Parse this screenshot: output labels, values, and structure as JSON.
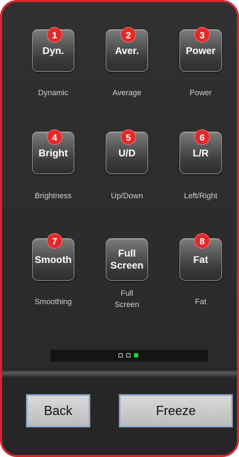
{
  "tiles": [
    {
      "label": "Dyn.",
      "badge": "1",
      "caption": "Dynamic"
    },
    {
      "label": "Aver.",
      "badge": "2",
      "caption": "Average"
    },
    {
      "label": "Power",
      "badge": "3",
      "caption": "Power"
    },
    {
      "label": "Bright",
      "badge": "4",
      "caption": "Brightness"
    },
    {
      "label": "U/D",
      "badge": "5",
      "caption": "Up/Down"
    },
    {
      "label": "L/R",
      "badge": "6",
      "caption": "Left/Right"
    },
    {
      "label": "Smooth",
      "badge": "7",
      "caption": "Smoothing"
    },
    {
      "label": "Full\nScreen",
      "badge": null,
      "caption": "Full\nScreen"
    },
    {
      "label": "Fat",
      "badge": "8",
      "caption": "Fat"
    }
  ],
  "pager": {
    "total": 3,
    "active_index": 2
  },
  "buttons": {
    "back": "Back",
    "freeze": "Freeze"
  },
  "colors": {
    "frame": "#d3262e",
    "badge": "#e02a2a",
    "active_dot": "#19d63a"
  }
}
